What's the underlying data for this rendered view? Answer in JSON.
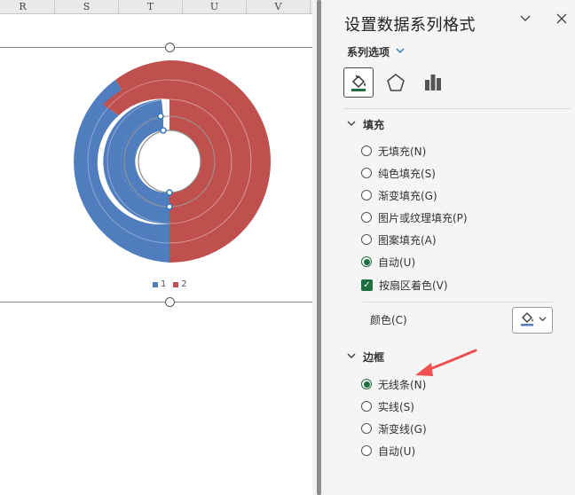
{
  "sheet": {
    "columns": [
      "R",
      "S",
      "T",
      "U",
      "V"
    ]
  },
  "chart": {
    "legend": [
      {
        "label": "1",
        "color": "#4f7dbd"
      },
      {
        "label": "2",
        "color": "#c0504d"
      }
    ]
  },
  "pane": {
    "title": "设置数据系列格式",
    "series_options": "系列选项",
    "fill": {
      "header": "填充",
      "options": [
        {
          "label": "无填充(N)",
          "checked": false
        },
        {
          "label": "纯色填充(S)",
          "checked": false
        },
        {
          "label": "渐变填充(G)",
          "checked": false
        },
        {
          "label": "图片或纹理填充(P)",
          "checked": false
        },
        {
          "label": "图案填充(A)",
          "checked": false
        },
        {
          "label": "自动(U)",
          "checked": true
        }
      ],
      "vary_by_slice": "按扇区着色(V)",
      "color_label": "颜色(C)"
    },
    "border": {
      "header": "边框",
      "options": [
        {
          "label": "无线条(N)",
          "checked": true
        },
        {
          "label": "实线(S)",
          "checked": false
        },
        {
          "label": "渐变线(G)",
          "checked": false
        },
        {
          "label": "自动(U)",
          "checked": false
        }
      ]
    }
  },
  "colors": {
    "series1": "#4f7dbd",
    "series2": "#c0504d",
    "accent_green": "#1f6e3f",
    "arrow": "#f05050"
  }
}
